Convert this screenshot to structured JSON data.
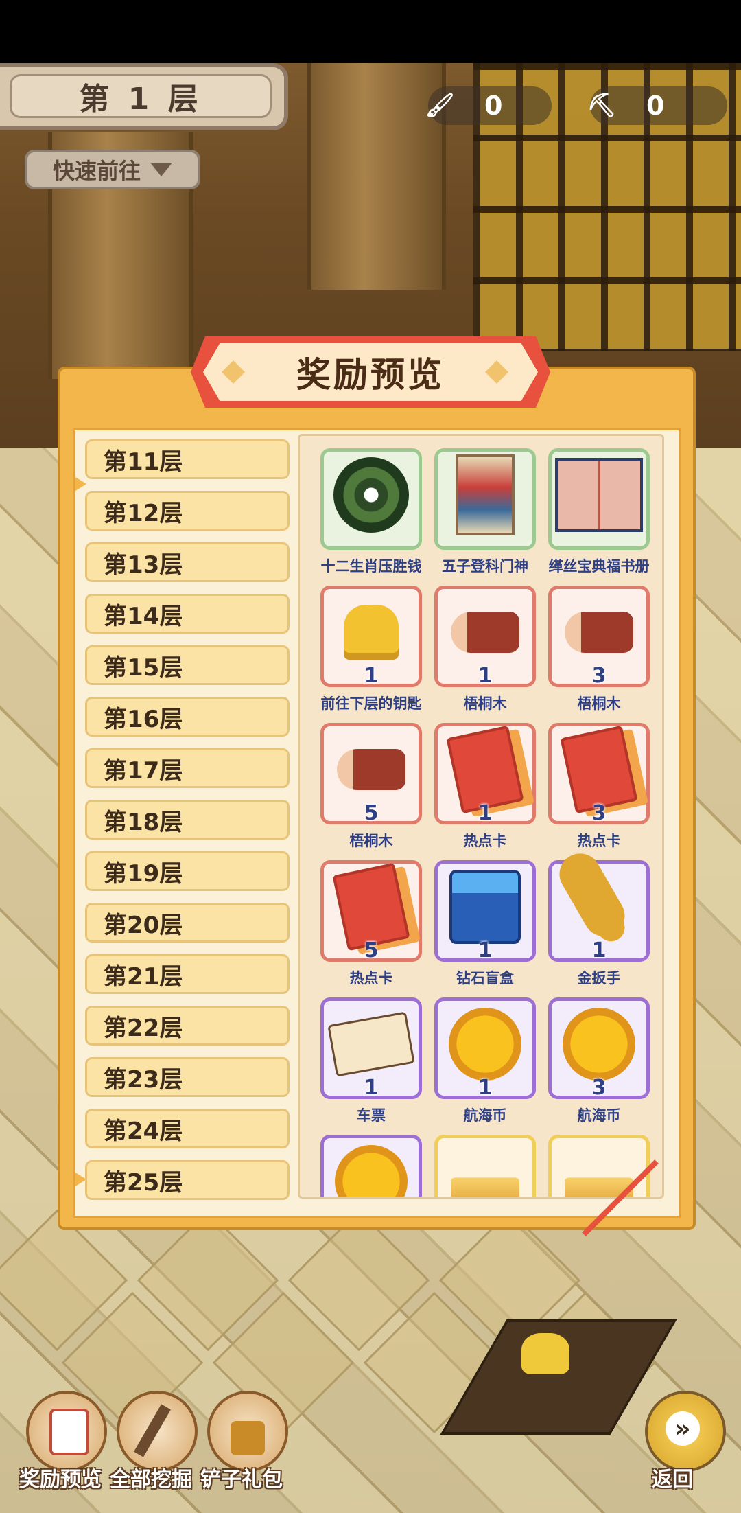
{
  "header": {
    "level_title": "第 1 层",
    "brush_count": "0",
    "shovel_count": "0",
    "quick_go_label": "快速前往"
  },
  "panel": {
    "title": "奖励预览",
    "floors": [
      "第11层",
      "第12层",
      "第13层",
      "第14层",
      "第15层",
      "第16层",
      "第17层",
      "第18层",
      "第19层",
      "第20层",
      "第21层",
      "第22层",
      "第23层",
      "第24层",
      "第25层"
    ],
    "rewards": [
      {
        "name": "十二生肖压胜钱",
        "count": "",
        "rarity": "green",
        "icon": "jade-coin-icon"
      },
      {
        "name": "五子登科门神",
        "count": "",
        "rarity": "green",
        "icon": "door-god-painting-icon"
      },
      {
        "name": "缂丝宝典福书册",
        "count": "",
        "rarity": "green",
        "icon": "silk-book-icon"
      },
      {
        "name": "前往下层的钥匙",
        "count": "1",
        "rarity": "red",
        "icon": "key-icon"
      },
      {
        "name": "梧桐木",
        "count": "1",
        "rarity": "red",
        "icon": "wood-log-icon"
      },
      {
        "name": "梧桐木",
        "count": "3",
        "rarity": "red",
        "icon": "wood-log-icon"
      },
      {
        "name": "梧桐木",
        "count": "5",
        "rarity": "red",
        "icon": "wood-log-icon"
      },
      {
        "name": "热点卡",
        "count": "1",
        "rarity": "red",
        "icon": "hot-card-icon"
      },
      {
        "name": "热点卡",
        "count": "3",
        "rarity": "red",
        "icon": "hot-card-icon"
      },
      {
        "name": "热点卡",
        "count": "5",
        "rarity": "red",
        "icon": "hot-card-icon"
      },
      {
        "name": "钻石盲盒",
        "count": "1",
        "rarity": "purple",
        "icon": "diamond-blind-box-icon"
      },
      {
        "name": "金扳手",
        "count": "1",
        "rarity": "purple",
        "icon": "golden-wrench-icon"
      },
      {
        "name": "车票",
        "count": "1",
        "rarity": "purple",
        "icon": "bus-ticket-icon"
      },
      {
        "name": "航海币",
        "count": "1",
        "rarity": "purple",
        "icon": "sailing-coin-icon"
      },
      {
        "name": "航海币",
        "count": "3",
        "rarity": "purple",
        "icon": "sailing-coin-icon"
      },
      {
        "name": "",
        "count": "",
        "rarity": "purple",
        "icon": "sailing-coin-icon"
      },
      {
        "name": "",
        "count": "",
        "rarity": "gold",
        "icon": "gold-bar-icon"
      },
      {
        "name": "",
        "count": "",
        "rarity": "gold",
        "icon": "gold-bar-icon"
      }
    ]
  },
  "bottom_bar": {
    "reward_preview": "奖励预览",
    "dig_all": "全部挖掘",
    "shovel_pack": "铲子礼包",
    "back": "返回"
  },
  "colors": {
    "panel_orange": "#f3b64b",
    "banner_red": "#e8513e",
    "text_blue": "#2e3f85"
  }
}
